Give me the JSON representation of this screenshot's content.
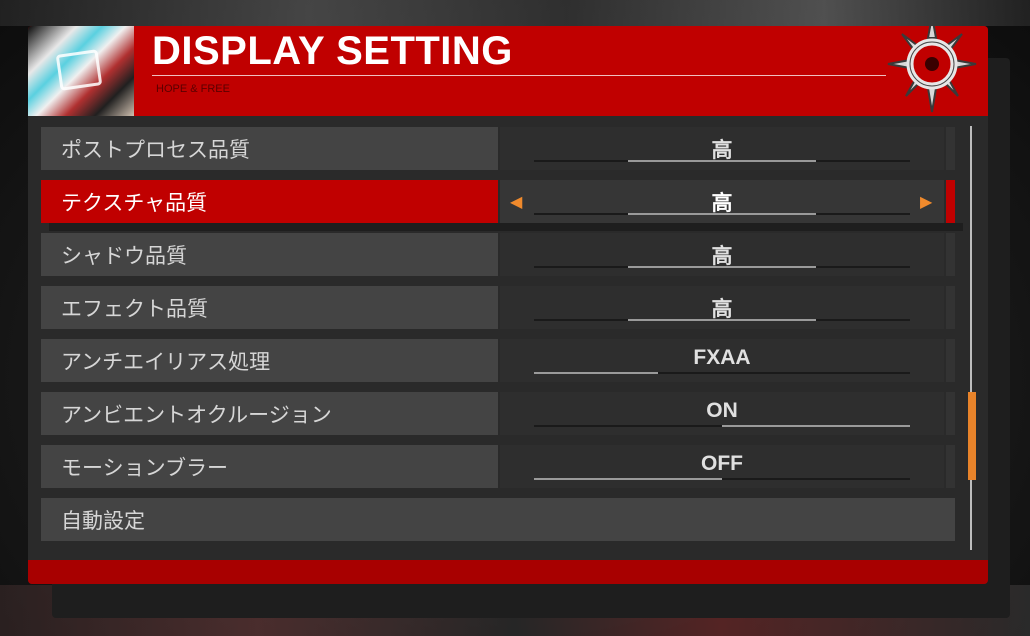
{
  "header": {
    "title": "DISPLAY SETTING",
    "subtitle": "HOPE & FREE"
  },
  "colors": {
    "accent_red": "#c00000",
    "arrow_orange": "#f08a2c",
    "scroll_orange": "#e8832a"
  },
  "settings": [
    {
      "label": "ポストプロセス品質",
      "value": "高",
      "level": 0.5,
      "selected": false
    },
    {
      "label": "テクスチャ品質",
      "value": "高",
      "level": 0.5,
      "selected": true
    },
    {
      "label": "シャドウ品質",
      "value": "高",
      "level": 0.5,
      "selected": false
    },
    {
      "label": "エフェクト品質",
      "value": "高",
      "level": 0.5,
      "selected": false
    },
    {
      "label": "アンチエイリアス処理",
      "value": "FXAA",
      "level": 0.33,
      "selected": false
    },
    {
      "label": "アンビエントオクルージョン",
      "value": "ON",
      "level": 1.0,
      "selected": false
    },
    {
      "label": "モーションブラー",
      "value": "OFF",
      "level": 0.0,
      "selected": false
    }
  ],
  "auto_setting_label": "自動設定",
  "icons": {
    "left_arrow": "left-arrow-icon",
    "right_arrow": "right-arrow-icon",
    "emblem": "crosshair-emblem-icon"
  },
  "scroll_position": 0.65
}
